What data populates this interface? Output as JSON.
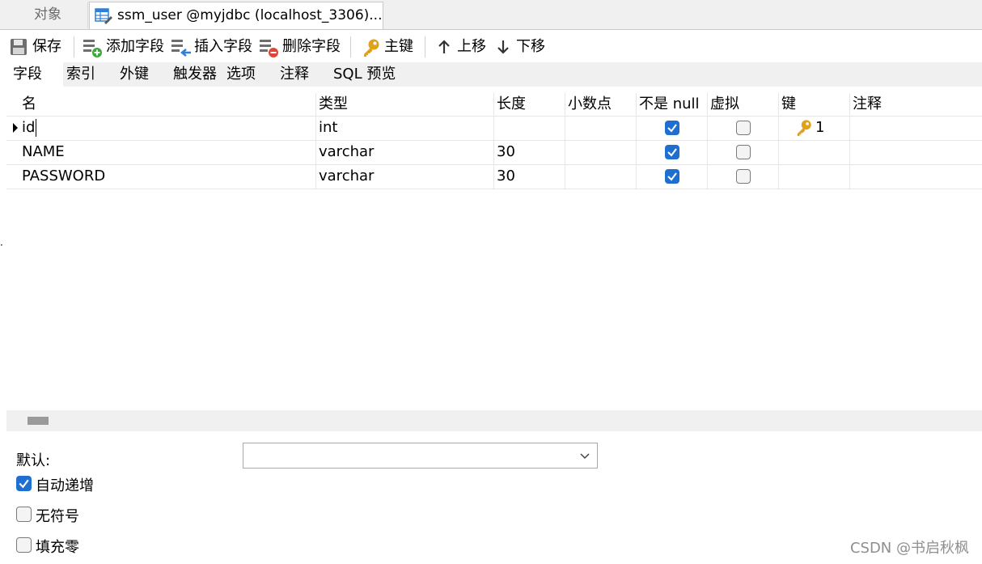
{
  "tabs": {
    "objects_label": "对象",
    "table_tab_label": "ssm_user @myjdbc (localhost_3306)..."
  },
  "toolbar": {
    "save": "保存",
    "add_field": "添加字段",
    "insert_field": "插入字段",
    "delete_field": "删除字段",
    "primary_key": "主键",
    "move_up": "上移",
    "move_down": "下移"
  },
  "subtabs": [
    "字段",
    "索引",
    "外键",
    "触发器",
    "选项",
    "注释",
    "SQL 预览"
  ],
  "grid": {
    "columns": [
      "名",
      "类型",
      "长度",
      "小数点",
      "不是 null",
      "虚拟",
      "键",
      "注释"
    ],
    "rows": [
      {
        "name": "id",
        "type": "int",
        "length": "",
        "decimals": "",
        "not_null": true,
        "virtual": false,
        "key": "1",
        "comment": ""
      },
      {
        "name": "NAME",
        "type": "varchar",
        "length": "30",
        "decimals": "",
        "not_null": true,
        "virtual": false,
        "key": "",
        "comment": ""
      },
      {
        "name": "PASSWORD",
        "type": "varchar",
        "length": "30",
        "decimals": "",
        "not_null": true,
        "virtual": false,
        "key": "",
        "comment": ""
      }
    ]
  },
  "properties": {
    "default_label": "默认:",
    "default_value": "",
    "auto_increment_label": "自动递增",
    "auto_increment": true,
    "unsigned_label": "无符号",
    "unsigned": false,
    "zerofill_label": "填充零",
    "zerofill": false
  },
  "watermark": "CSDN @书启秋枫",
  "colors": {
    "accent": "#1f6fd1",
    "key_icon": "#e0a21a",
    "add_icon": "#3aa93a",
    "delete_icon": "#e0453a",
    "insert_arrow": "#2f7fd6"
  }
}
